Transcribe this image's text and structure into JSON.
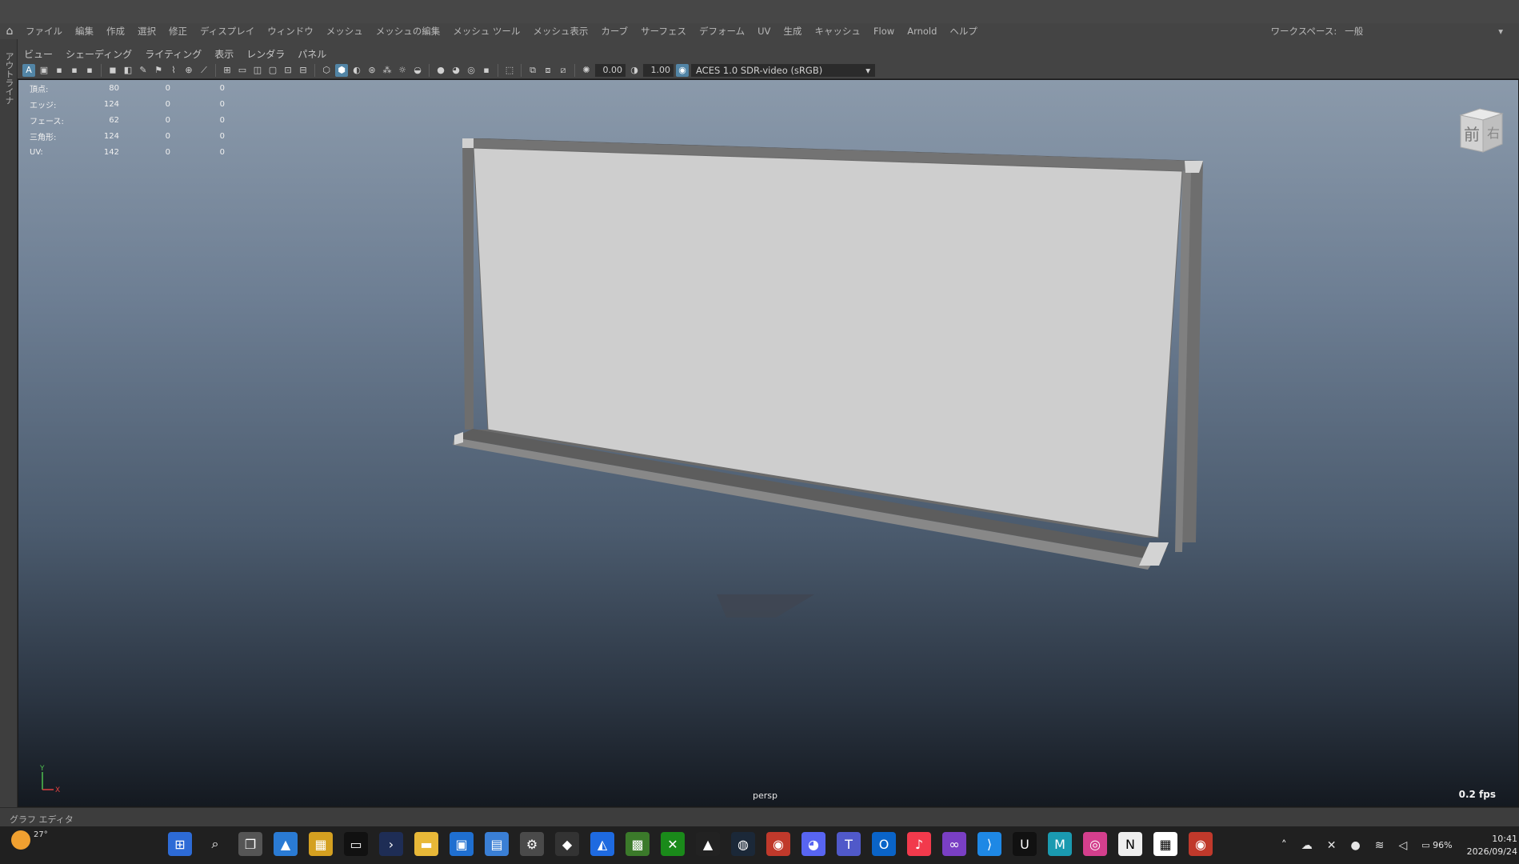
{
  "menubar": {
    "items": [
      "ファイル",
      "編集",
      "作成",
      "選択",
      "修正",
      "ディスプレイ",
      "ウィンドウ",
      "メッシュ",
      "メッシュの編集",
      "メッシュ ツール",
      "メッシュ表示",
      "カーブ",
      "サーフェス",
      "デフォーム",
      "UV",
      "生成",
      "キャッシュ",
      "Flow",
      "Arnold",
      "ヘルプ"
    ],
    "colorspace_label": "ワークスペース:",
    "colorspace_value": "一般"
  },
  "outliner_tab": "アウトライナ",
  "panel_menu": [
    "ビュー",
    "シェーディング",
    "ライティング",
    "表示",
    "レンダラ",
    "パネル"
  ],
  "toolbar": {
    "exposure": "0.00",
    "gamma": "1.00",
    "color_transform": "ACES 1.0 SDR-video (sRGB)"
  },
  "hud": [
    {
      "label": "頂点:",
      "v1": "80",
      "v2": "0",
      "v3": "0"
    },
    {
      "label": "エッジ:",
      "v1": "124",
      "v2": "0",
      "v3": "0"
    },
    {
      "label": "フェース:",
      "v1": "62",
      "v2": "0",
      "v3": "0"
    },
    {
      "label": "三角形:",
      "v1": "124",
      "v2": "0",
      "v3": "0"
    },
    {
      "label": "UV:",
      "v1": "142",
      "v2": "0",
      "v3": "0"
    }
  ],
  "viewcube": {
    "front": "前",
    "right": "右"
  },
  "camera_label": "persp",
  "fps": "0.2 fps",
  "axis": {
    "y": "Y",
    "x": "X"
  },
  "graph_editor_label": "グラフ エディタ",
  "taskbar": {
    "temperature": "27°",
    "battery": "96%",
    "time": "10:41",
    "date": "2026/09/24",
    "app_icons": [
      "windows-start",
      "search",
      "task-view",
      "photos",
      "paint",
      "terminal",
      "powershell",
      "file-explorer",
      "ms-store",
      "calculator",
      "settings",
      "unity",
      "affinity",
      "minecraft",
      "xbox",
      "epic-games",
      "steam",
      "chrome",
      "discord",
      "teams",
      "outlook",
      "music",
      "visual-studio",
      "vscode",
      "unreal",
      "maya",
      "instagram",
      "notion",
      "calendar",
      "chrome-2"
    ]
  },
  "colors": {
    "accent": "#5285a6",
    "viewport_top": "#8b9aab",
    "viewport_bottom": "#141920",
    "panel": "#444444",
    "taskbar": "#202020"
  }
}
